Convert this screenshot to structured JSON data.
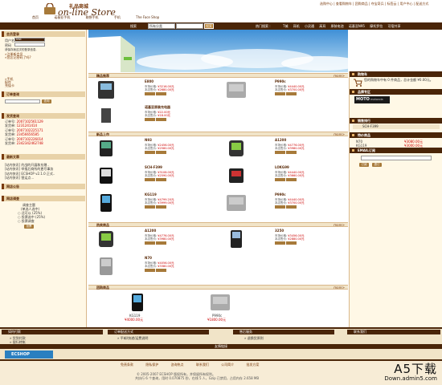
{
  "header": {
    "logo_cn": "礼品商城",
    "logo_en": "on-line Store",
    "top_links": "选购中心 | 查看购物车 | 团购商品 | 夺宝奇兵 | 标签云 | 用户中心 | 配送方式",
    "categories": [
      "首页",
      "诺基亚手机",
      "联想手机",
      "手机",
      "The Face Shop"
    ]
  },
  "search": {
    "label": "搜索",
    "select_value": "所有分类",
    "button": "搜索",
    "hot_label": "热门搜索 :",
    "hot_links": [
      "T城",
      "耳机",
      "小灵通",
      "高耳",
      "原装电池",
      "诺基亚N95",
      "摩托罗拉",
      "可宿共享"
    ]
  },
  "left": {
    "member_title": "会员登录",
    "user_label": "用户名",
    "user_value": "test",
    "pass_label": "密码",
    "save_login": "请保存我这次的登录信息.",
    "login_btn": "登录",
    "register_btn": "注册",
    "register_link": "»注册新会员",
    "forgot_link": "»您忘记密码了吗?",
    "tree_items": [
      "»手机",
      "配件",
      "充值卡"
    ],
    "order_title": "订单查询",
    "order_btn": "查询",
    "invoice_title": "发货查询",
    "invoice_rows": [
      {
        "k": "订单号:",
        "v": "2007102561129"
      },
      {
        "k": "发货单:",
        "v": "1231241414"
      },
      {
        "k": "订单号:",
        "v": "2007102225171"
      },
      {
        "k": "发货单:",
        "v": "23456656585"
      },
      {
        "k": "订单号:",
        "v": "2007102226014"
      },
      {
        "k": "发货单:",
        "v": "2342342462748"
      }
    ],
    "news_title": "最新文章",
    "news_items": [
      "[站内快讯] 约战的开展和东赠..",
      "[站内快讯] 举报后商所的更尽事务",
      "[站内快讯] ECSHOP v2.1.0 正式..",
      "[站内快讯] 营运点..."
    ],
    "ad_title": "网店公告",
    "vote_title": "网店调查",
    "vote_question": "调查主题",
    "vote_sub": "(单选人选中)",
    "vote_options": [
      "○ 还可以 (25%)",
      "○ 投票选中 (25%)",
      "○ 投票调查"
    ],
    "vote_btn": "投票"
  },
  "sections": {
    "best": {
      "title": "精品推荐",
      "more": "more>"
    },
    "new": {
      "title": "新品上市",
      "more": "more>"
    },
    "hot": {
      "title": "热卖商品",
      "more": "more>"
    },
    "group": {
      "title": "团购商品",
      "more": "more>"
    }
  },
  "products": {
    "best": [
      {
        "name": "E800",
        "p1": "市场价格: ",
        "v1": "¥3216.00元",
        "p2": "本店售价: ",
        "v2": "¥2680.00元"
      },
      {
        "name": "P990c",
        "p1": "市场价格: ",
        "v1": "¥4440.00元",
        "p2": "本店售价: ",
        "v2": "¥3700.00元"
      },
      {
        "name": "诺基亚原装充电器",
        "p1": "市场价格: ",
        "v1": "¥22.00元",
        "p2": "本店售价: ",
        "v2": "¥18.00元"
      }
    ],
    "new": [
      {
        "name": "N93",
        "p1": "市场价格: ",
        "v1": "¥2456.00元",
        "p2": "本店售价: ",
        "v2": "¥2580.00元"
      },
      {
        "name": "A1200",
        "p1": "市场价格: ",
        "v1": "¥4776.00元",
        "p2": "本店售价: ",
        "v2": "¥3980.00元"
      },
      {
        "name": "SCH-F399",
        "p1": "市场价格: ",
        "v1": "¥3108.00元",
        "p2": "本店售价: ",
        "v2": "¥2590.00元"
      },
      {
        "name": "LOKG99",
        "p1": "市场价格: ",
        "v1": "¥4440.00元",
        "p2": "本店售价: ",
        "v2": "¥3660.00元"
      },
      {
        "name": "KG119",
        "p1": "市场价格: ",
        "v1": "¥4799.20元",
        "p2": "本店售价: ",
        "v2": "¥3999.00元"
      },
      {
        "name": "P990c",
        "p1": "市场价格: ",
        "v1": "¥4440.00元",
        "p2": "本店售价: ",
        "v2": "¥3700.00元"
      }
    ],
    "hot": [
      {
        "name": "A1200",
        "p1": "市场价格: ",
        "v1": "¥4776.00元",
        "p2": "本店售价: ",
        "v2": "¥3980.00元"
      },
      {
        "name": "3250",
        "p1": "市场价格: ",
        "v1": "¥3456.00元",
        "p2": "本店售价: ",
        "v2": "¥2880.00元"
      },
      {
        "name": "N70",
        "p1": "市场价格: ",
        "v1": "¥4056.00元",
        "p2": "本店售价: ",
        "v2": "¥3380.00元"
      }
    ],
    "group": [
      {
        "name": "KG119",
        "price": "¥4000.00元"
      },
      {
        "name": "P990c",
        "price": "¥1800.00元"
      }
    ]
  },
  "right": {
    "cart_title": "购物车",
    "cart_text": "您的购物车中有 0 件商品，总计金额 ¥0.00元。",
    "brand_title": "品牌专区",
    "brand_logo": "MOTO",
    "brand_sub": "motorola",
    "sale_title": "销售排行",
    "sale_row": "SCH-F399",
    "bargain_title": "特价商品",
    "bargain_rows": [
      {
        "name": "N70",
        "price": "¥3080.00元"
      },
      {
        "name": "KG119",
        "price": "¥3000.00元"
      }
    ],
    "email_title": "EMAIL订阅",
    "email_btns": [
      "订阅",
      "退订"
    ]
  },
  "bottom": {
    "col1_title": "如何付款",
    "col1_items": [
      "» 货到付款",
      "» 银行转帐"
    ],
    "col2_title": "订单配送方式",
    "col2_items": [
      "» 平邮/快递/运费说明"
    ],
    "col3_title": "售后服务",
    "col3_items": [
      "» 退换货原则"
    ],
    "col4_title": "联系我们",
    "links_title": "友情链接",
    "ecshop_logo": "ECSHOP"
  },
  "footer": {
    "nav": [
      "免责条款",
      "隐私保护",
      "咨询热点",
      "联系我们",
      "公司简介",
      "批发方案"
    ],
    "copyright": "© 2005-2007 ECSHOP 版权所有，并保留所有权利。",
    "stats": "共执行 6 个查询，用时 0.070875 秒，在线 5 人，Gzip 已禁用，占用内存 2.658 MB",
    "watermark_big": "A5下载",
    "watermark_small": "Down.admin5.com"
  },
  "colors": {
    "brand_dark": "#4a2508",
    "brand": "#7a3b0e",
    "panel": "#fff8e6",
    "price_red": "#cc0000"
  }
}
